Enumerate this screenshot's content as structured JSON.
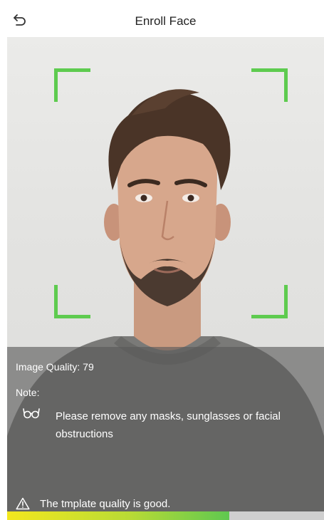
{
  "header": {
    "title": "Enroll Face",
    "back_icon": "back-arrow-icon"
  },
  "camera": {
    "frame_color": "#5ecb4f"
  },
  "info": {
    "image_quality": "Image Quality: 79",
    "note_label": "Note:",
    "note_icon": "glasses-icon",
    "note_text": "Please remove any masks, sunglasses or facial obstructions",
    "status_icon": "warning-icon",
    "status_text": "The tmplate quality is good."
  },
  "quality_bar": {
    "level": 0.7
  }
}
